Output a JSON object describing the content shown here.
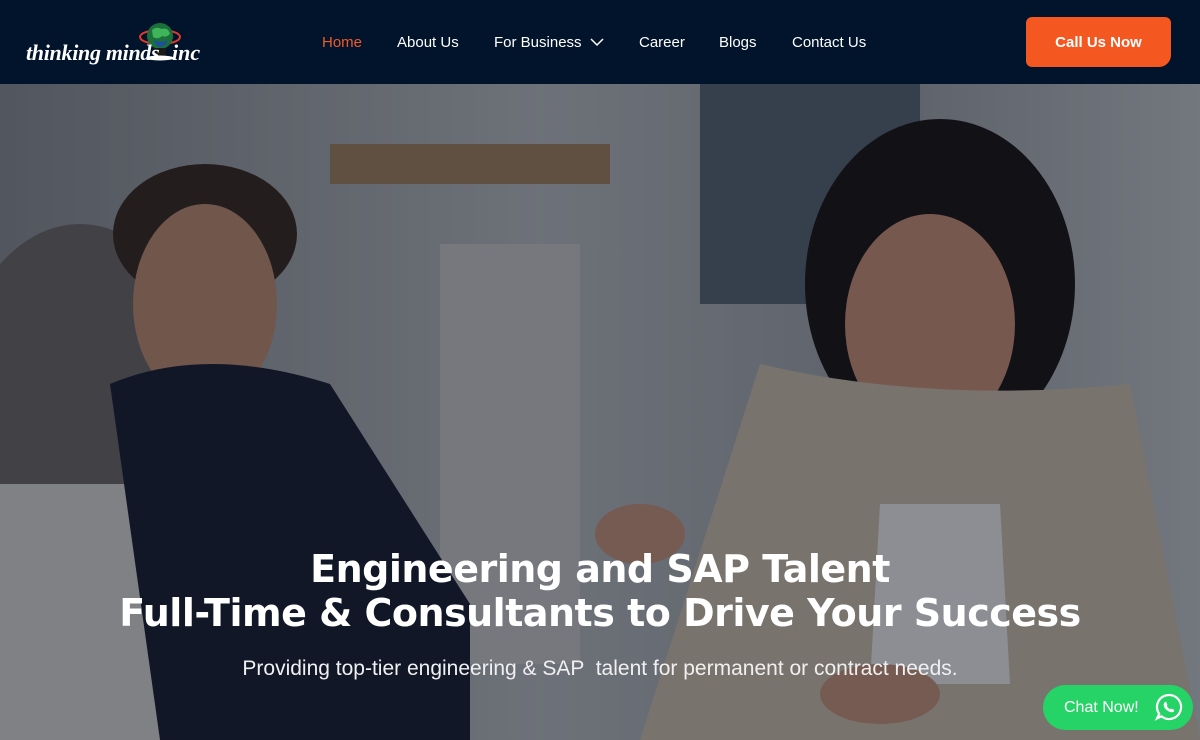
{
  "navbar": {
    "logo": {
      "text_left": "thinking minds",
      "text_right": "inc"
    },
    "links": [
      {
        "label": "Home",
        "active": true
      },
      {
        "label": "About Us",
        "active": false
      },
      {
        "label": "For Business",
        "active": false,
        "has_dropdown": true
      },
      {
        "label": "Career",
        "active": false
      },
      {
        "label": "Blogs",
        "active": false
      },
      {
        "label": "Contact Us",
        "active": false
      }
    ],
    "cta_label": "Call Us Now"
  },
  "hero": {
    "title_line1": "Engineering and SAP Talent",
    "title_line2": "Full-Time & Consultants to Drive Your Success",
    "subtitle": "Providing top-tier engineering & SAP  talent for permanent or contract needs."
  },
  "chat_widget": {
    "label": "Chat Now!"
  },
  "colors": {
    "nav_bg": "#01142b",
    "accent": "#f4571f",
    "active_link": "#f05a28",
    "chat_green": "#25d366"
  }
}
